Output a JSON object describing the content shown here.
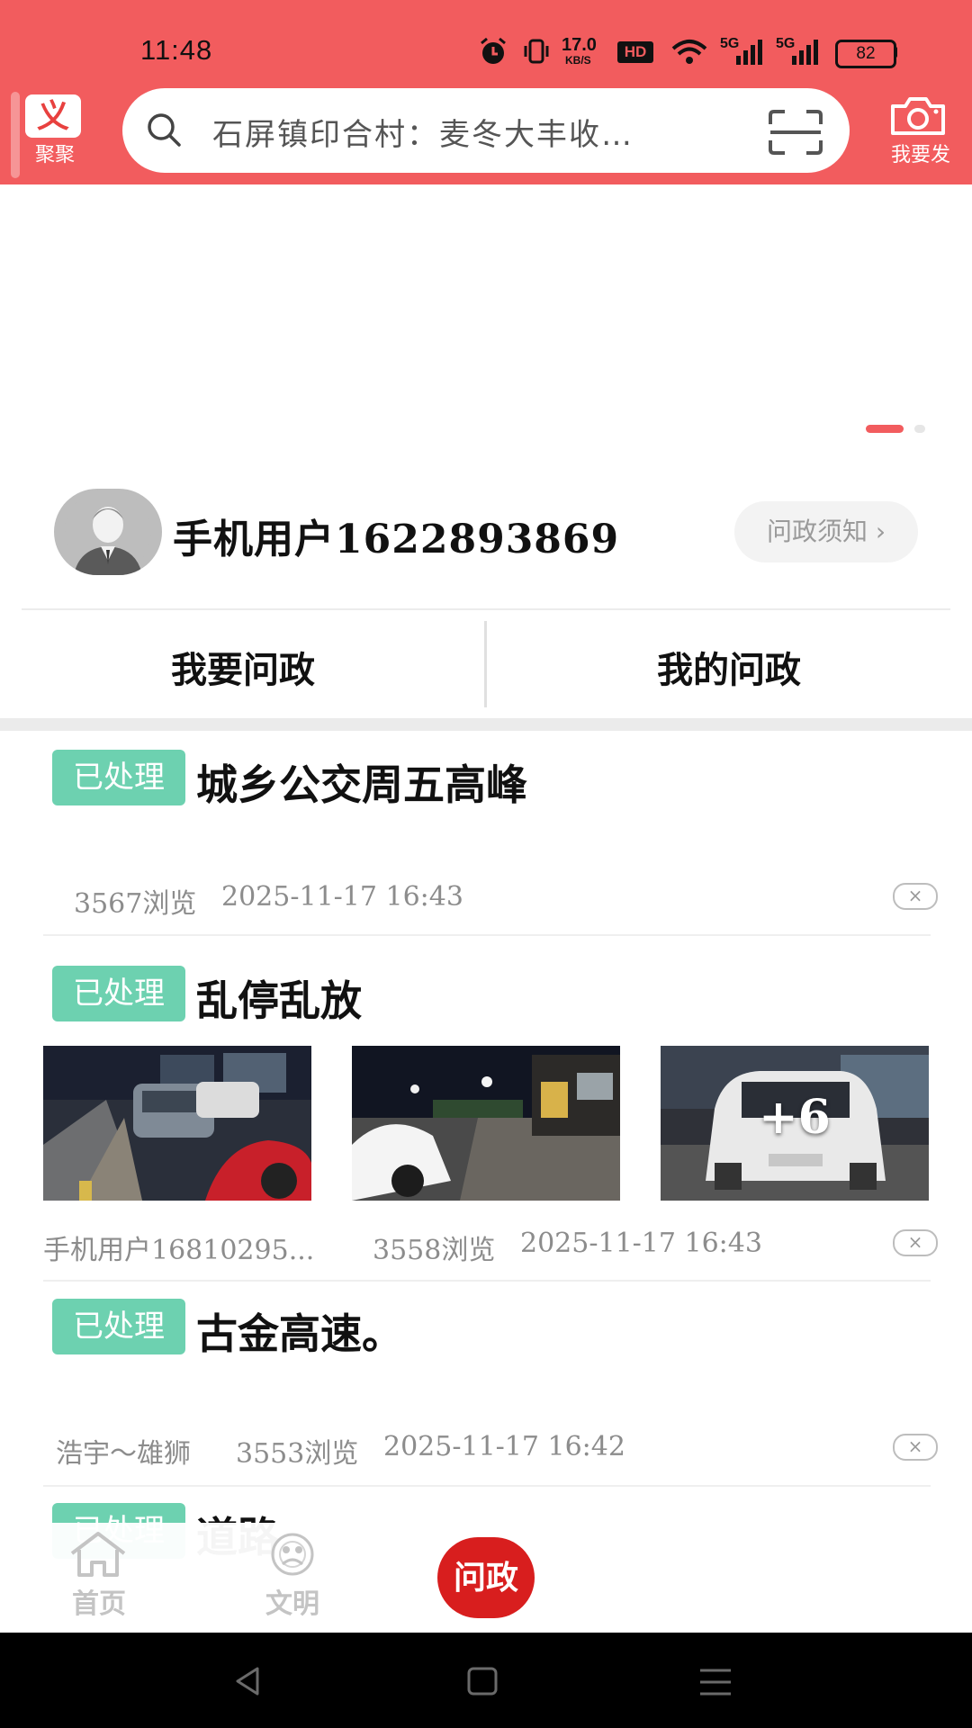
{
  "status_bar": {
    "time": "11:48",
    "net_speed": "17.0",
    "net_unit": "KB/S",
    "hd": "HD",
    "signal_1": "5G",
    "signal_2": "5G",
    "battery": "82"
  },
  "header": {
    "logo_glyph": "义",
    "logo_label": "聚聚",
    "search_text": "石屏镇印合村：麦冬大丰收…",
    "camera_label": "我要发",
    "accent_color": "#f25c5e"
  },
  "profile": {
    "username": "手机用户1622893869",
    "notice_label": "问政须知",
    "notice_chevron": "›"
  },
  "tabs": [
    {
      "label": "我要问政"
    },
    {
      "label": "我的问政"
    }
  ],
  "posts": [
    {
      "status": "已处理",
      "title": "城乡公交周五高峰",
      "author": "",
      "views": "3567浏览",
      "date": "2025-11-17 16:43"
    },
    {
      "status": "已处理",
      "title": "乱停乱放",
      "author": "手机用户16810295...",
      "views": "3558浏览",
      "date": "2025-11-17 16:43",
      "extra_images": "+6"
    },
    {
      "status": "已处理",
      "title": "古金高速。",
      "author": "浩宇～雄狮",
      "views": "3553浏览",
      "date": "2025-11-17 16:42"
    },
    {
      "status": "已处理",
      "title": "道路"
    }
  ],
  "close_glyph": "×",
  "bottom_nav": {
    "home": "首页",
    "civil": "文明",
    "center": "问政"
  }
}
